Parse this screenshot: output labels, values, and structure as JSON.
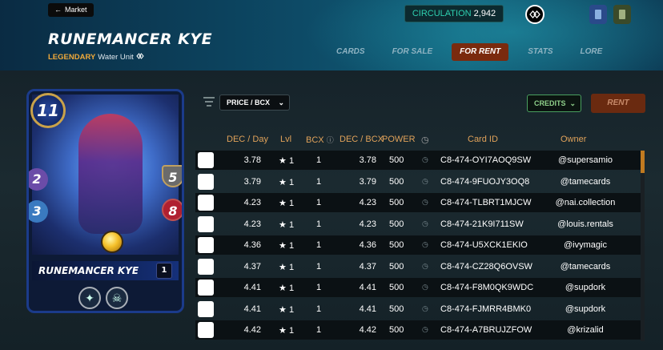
{
  "header": {
    "back_label": "Market",
    "card_name": "RUNEMANCER KYE",
    "rarity": "LEGENDARY",
    "unit_type": "Water Unit",
    "circulation_label": "CIRCULATION",
    "circulation_value": "2,942",
    "tabs": [
      {
        "label": "CARDS",
        "active": false
      },
      {
        "label": "FOR SALE",
        "active": false
      },
      {
        "label": "FOR RENT",
        "active": true
      },
      {
        "label": "STATS",
        "active": false
      },
      {
        "label": "LORE",
        "active": false
      }
    ]
  },
  "card": {
    "mana": "11",
    "melee": "2",
    "magic": "3",
    "armor": "5",
    "health": "8",
    "name": "RUNEMANCER KYE",
    "level": "1",
    "abilities": [
      "wings-icon",
      "skull-icon"
    ]
  },
  "controls": {
    "sort_value": "PRICE / BCX",
    "currency_value": "CREDITS",
    "rent_label": "RENT"
  },
  "table": {
    "headers": {
      "dec_day": "DEC / Day",
      "lvl": "Lvl",
      "bcx": "BCX",
      "dec_bcx": "DEC / BCX",
      "power": "POWER",
      "card_id": "Card ID",
      "owner": "Owner"
    },
    "rows": [
      {
        "dec_day": "3.78",
        "lvl": "1",
        "bcx": "1",
        "dec_bcx": "3.78",
        "power": "500",
        "card_id": "C8-474-OYI7AOQ9SW",
        "owner": "@supersamio"
      },
      {
        "dec_day": "3.79",
        "lvl": "1",
        "bcx": "1",
        "dec_bcx": "3.79",
        "power": "500",
        "card_id": "C8-474-9FUOJY3OQ8",
        "owner": "@tamecards"
      },
      {
        "dec_day": "4.23",
        "lvl": "1",
        "bcx": "1",
        "dec_bcx": "4.23",
        "power": "500",
        "card_id": "C8-474-TLBRT1MJCW",
        "owner": "@nai.collection"
      },
      {
        "dec_day": "4.23",
        "lvl": "1",
        "bcx": "1",
        "dec_bcx": "4.23",
        "power": "500",
        "card_id": "C8-474-21K9I711SW",
        "owner": "@louis.rentals"
      },
      {
        "dec_day": "4.36",
        "lvl": "1",
        "bcx": "1",
        "dec_bcx": "4.36",
        "power": "500",
        "card_id": "C8-474-U5XCK1EKIO",
        "owner": "@ivymagic"
      },
      {
        "dec_day": "4.37",
        "lvl": "1",
        "bcx": "1",
        "dec_bcx": "4.37",
        "power": "500",
        "card_id": "C8-474-CZ28Q6OVSW",
        "owner": "@tamecards"
      },
      {
        "dec_day": "4.41",
        "lvl": "1",
        "bcx": "1",
        "dec_bcx": "4.41",
        "power": "500",
        "card_id": "C8-474-F8M0QK9WDC",
        "owner": "@supdork"
      },
      {
        "dec_day": "4.41",
        "lvl": "1",
        "bcx": "1",
        "dec_bcx": "4.41",
        "power": "500",
        "card_id": "C8-474-FJMRR4BMK0",
        "owner": "@supdork"
      },
      {
        "dec_day": "4.42",
        "lvl": "1",
        "bcx": "1",
        "dec_bcx": "4.42",
        "power": "500",
        "card_id": "C8-474-A7BRUJZFOW",
        "owner": "@krizalid"
      }
    ]
  },
  "colors": {
    "accent_orange": "#e0a25a",
    "active_tab": "#7a2a0e",
    "circulation_text": "#2ed0b0",
    "legendary": "#f0a93a"
  }
}
